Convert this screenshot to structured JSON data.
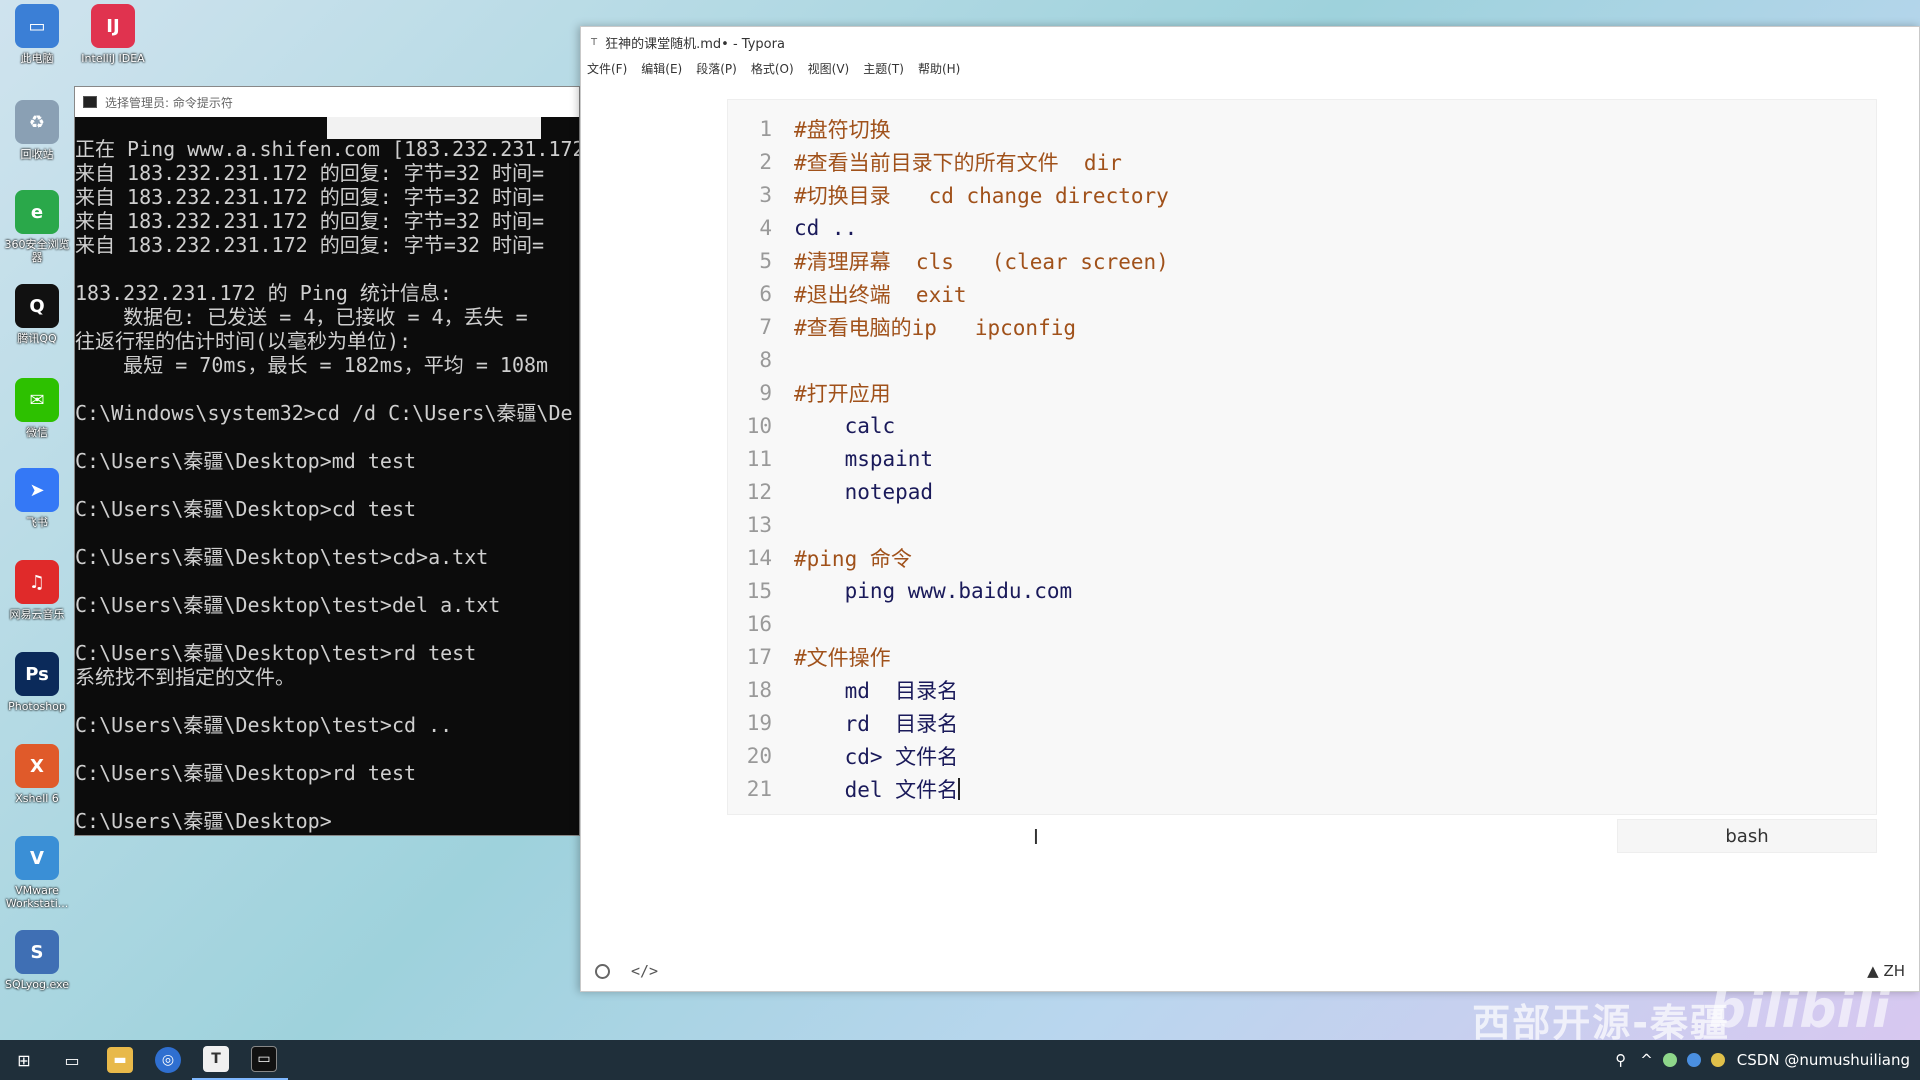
{
  "desktop": {
    "icons": [
      {
        "label": "此电脑",
        "glyph": "▭",
        "color": "#3b7fd6"
      },
      {
        "label": "IntelliJ IDEA",
        "glyph": "IJ",
        "color": "#e0334f"
      },
      {
        "label": "回收站",
        "glyph": "♻",
        "color": "#8aa0b4"
      },
      {
        "label": "360安全浏览器",
        "glyph": "e",
        "color": "#2aa84a"
      },
      {
        "label": "腾讯QQ",
        "glyph": "Q",
        "color": "#111111"
      },
      {
        "label": "微信",
        "glyph": "✉",
        "color": "#2dc100"
      },
      {
        "label": "飞书",
        "glyph": "➤",
        "color": "#3478f6"
      },
      {
        "label": "网易云音乐",
        "glyph": "♫",
        "color": "#e02a2a"
      },
      {
        "label": "Photoshop",
        "glyph": "Ps",
        "color": "#0b2a5a"
      },
      {
        "label": "Xshell 6",
        "glyph": "X",
        "color": "#e05a2a"
      },
      {
        "label": "VMware Workstati...",
        "glyph": "V",
        "color": "#3a8fd6"
      },
      {
        "label": "SQLyog.exe",
        "glyph": "S",
        "color": "#3f6fb4"
      }
    ]
  },
  "cmd": {
    "title": "选择管理员: 命令提示符",
    "lines": [
      "正在 Ping www.a.shifen.com [183.232.231.172]",
      "来自 183.232.231.172 的回复: 字节=32 时间=",
      "来自 183.232.231.172 的回复: 字节=32 时间=",
      "来自 183.232.231.172 的回复: 字节=32 时间=",
      "来自 183.232.231.172 的回复: 字节=32 时间=",
      "",
      "183.232.231.172 的 Ping 统计信息:",
      "    数据包: 已发送 = 4，已接收 = 4，丢失 =",
      "往返行程的估计时间(以毫秒为单位):",
      "    最短 = 70ms，最长 = 182ms，平均 = 108m",
      "",
      "C:\\Windows\\system32>cd /d C:\\Users\\秦疆\\De",
      "",
      "C:\\Users\\秦疆\\Desktop>md test",
      "",
      "C:\\Users\\秦疆\\Desktop>cd test",
      "",
      "C:\\Users\\秦疆\\Desktop\\test>cd>a.txt",
      "",
      "C:\\Users\\秦疆\\Desktop\\test>del a.txt",
      "",
      "C:\\Users\\秦疆\\Desktop\\test>rd test",
      "系统找不到指定的文件。",
      "",
      "C:\\Users\\秦疆\\Desktop\\test>cd ..",
      "",
      "C:\\Users\\秦疆\\Desktop>rd test",
      "",
      "C:\\Users\\秦疆\\Desktop>"
    ]
  },
  "typora": {
    "title": "狂神的课堂随机.md• - Typora",
    "menu": [
      "文件(F)",
      "编辑(E)",
      "段落(P)",
      "格式(O)",
      "视图(V)",
      "主题(T)",
      "帮助(H)"
    ],
    "code": [
      {
        "n": "1",
        "t": "#盘符切换",
        "c": true
      },
      {
        "n": "2",
        "t": "#查看当前目录下的所有文件  dir",
        "c": true
      },
      {
        "n": "3",
        "t": "#切换目录   cd change directory",
        "c": true
      },
      {
        "n": "4",
        "t": "cd ..",
        "c": false
      },
      {
        "n": "5",
        "t": "#清理屏幕  cls   (clear screen)",
        "c": true
      },
      {
        "n": "6",
        "t": "#退出终端  exit",
        "c": true
      },
      {
        "n": "7",
        "t": "#查看电脑的ip   ipconfig",
        "c": true
      },
      {
        "n": "8",
        "t": "",
        "c": false
      },
      {
        "n": "9",
        "t": "#打开应用",
        "c": true
      },
      {
        "n": "10",
        "t": "    calc",
        "c": false
      },
      {
        "n": "11",
        "t": "    mspaint",
        "c": false
      },
      {
        "n": "12",
        "t": "    notepad",
        "c": false
      },
      {
        "n": "13",
        "t": "",
        "c": false
      },
      {
        "n": "14",
        "t": "#ping 命令",
        "c": true
      },
      {
        "n": "15",
        "t": "    ping www.baidu.com",
        "c": false
      },
      {
        "n": "16",
        "t": "",
        "c": false
      },
      {
        "n": "17",
        "t": "#文件操作",
        "c": true
      },
      {
        "n": "18",
        "t": "    md  目录名",
        "c": false
      },
      {
        "n": "19",
        "t": "    rd  目录名",
        "c": false
      },
      {
        "n": "20",
        "t": "    cd> 文件名",
        "c": false
      },
      {
        "n": "21",
        "t": "    del 文件名",
        "c": false
      }
    ],
    "language": "bash",
    "source_toggle": "</>",
    "ime": "ZH"
  },
  "watermark": {
    "text": "西部开源-秦疆",
    "brand": "bilibili"
  },
  "taskbar": {
    "tray_text": "CSDN @numushuiliang"
  }
}
